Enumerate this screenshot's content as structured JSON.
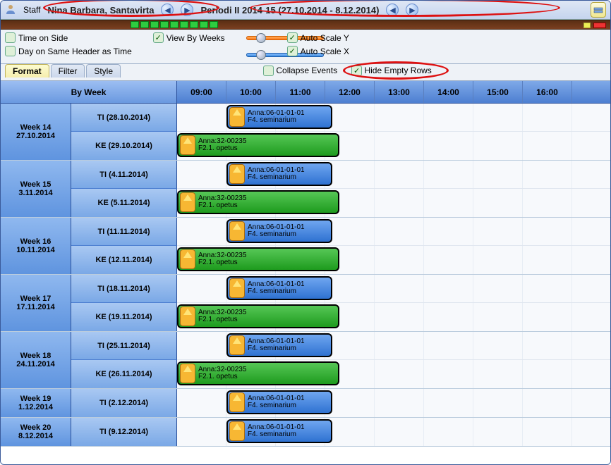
{
  "topbar": {
    "type_label": "Staff",
    "name": "Nina Barbara, Santavirta",
    "period": "Periodi II 2014-15 (27.10.2014 - 8.12.2014)"
  },
  "options": {
    "time_on_side": {
      "label": "Time on Side",
      "checked": false
    },
    "view_by_weeks": {
      "label": "View By Weeks",
      "checked": true
    },
    "day_same_header": {
      "label": "Day on Same Header as Time",
      "checked": false
    },
    "auto_scale_y": {
      "label": "Auto Scale Y",
      "checked": true
    },
    "auto_scale_x": {
      "label": "Auto Scale X",
      "checked": true
    },
    "collapse_events": {
      "label": "Collapse Events",
      "checked": false
    },
    "hide_empty_rows": {
      "label": "Hide Empty Rows",
      "checked": true
    }
  },
  "tabs": {
    "format": "Format",
    "filter": "Filter",
    "style": "Style"
  },
  "timetable": {
    "by_week_label": "By Week",
    "hours": [
      "09:00",
      "10:00",
      "11:00",
      "12:00",
      "13:00",
      "14:00",
      "15:00",
      "16:00"
    ],
    "event_a": {
      "title": "Anna:06-01-01-01",
      "sub": "F4. seminarium"
    },
    "event_b": {
      "title": "Anna:32-00235",
      "sub": "F2.1. opetus"
    },
    "weeks": [
      {
        "wk": "Week 14",
        "date": "27.10.2014",
        "days": [
          {
            "label": "TI (28.10.2014)",
            "ev": "a"
          },
          {
            "label": "KE (29.10.2014)",
            "ev": "b"
          }
        ]
      },
      {
        "wk": "Week 15",
        "date": "3.11.2014",
        "days": [
          {
            "label": "TI (4.11.2014)",
            "ev": "a"
          },
          {
            "label": "KE (5.11.2014)",
            "ev": "b"
          }
        ]
      },
      {
        "wk": "Week 16",
        "date": "10.11.2014",
        "days": [
          {
            "label": "TI (11.11.2014)",
            "ev": "a"
          },
          {
            "label": "KE (12.11.2014)",
            "ev": "b"
          }
        ]
      },
      {
        "wk": "Week 17",
        "date": "17.11.2014",
        "days": [
          {
            "label": "TI (18.11.2014)",
            "ev": "a"
          },
          {
            "label": "KE (19.11.2014)",
            "ev": "b"
          }
        ]
      },
      {
        "wk": "Week 18",
        "date": "24.11.2014",
        "days": [
          {
            "label": "TI (25.11.2014)",
            "ev": "a"
          },
          {
            "label": "KE (26.11.2014)",
            "ev": "b"
          }
        ]
      },
      {
        "wk": "Week 19",
        "date": "1.12.2014",
        "days": [
          {
            "label": "TI (2.12.2014)",
            "ev": "a"
          }
        ]
      },
      {
        "wk": "Week 20",
        "date": "8.12.2014",
        "days": [
          {
            "label": "TI (9.12.2014)",
            "ev": "a"
          }
        ]
      }
    ]
  }
}
